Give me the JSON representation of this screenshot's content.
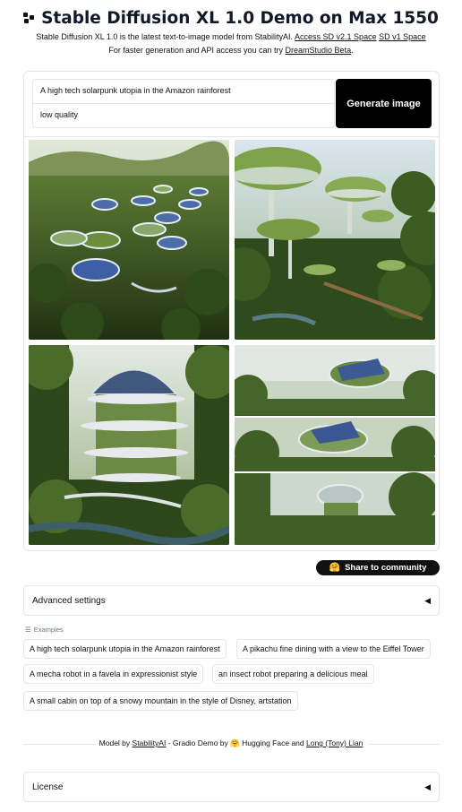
{
  "header": {
    "title": "Stable Diffusion XL 1.0 Demo on Max 1550",
    "desc_prefix": "Stable Diffusion XL 1.0 is the latest text-to-image model from StabilityAI.",
    "link_sd21": "Access SD v2.1 Space",
    "link_sd1": "SD v1 Space",
    "faster_prefix": "For faster generation and API access you can try",
    "faster_link": "DreamStudio Beta",
    "faster_suffix": "."
  },
  "prompt": {
    "value": "A high tech solarpunk utopia in the Amazon rainforest",
    "negative": "low quality"
  },
  "generate_label": "Generate image",
  "share_label": "Share to community",
  "advanced_label": "Advanced settings",
  "examples_label": "Examples",
  "examples": [
    "A high tech solarpunk utopia in the Amazon rainforest",
    "A pikachu fine dining with a view to the Eiffel Tower",
    "A mecha robot in a favela in expressionist style",
    "an insect robot preparing a delicious meal",
    "A small cabin on top of a snowy mountain in the style of Disney, artstation"
  ],
  "footer": {
    "prefix": "Model by",
    "stability": "StabilityAI",
    "middle": "- Gradio Demo by",
    "hf": "Hugging Face",
    "and": "and",
    "author": "Long (Tony) Lian"
  },
  "license_label": "License",
  "colors": {
    "accent": "#000000",
    "border": "#e5e7eb"
  }
}
